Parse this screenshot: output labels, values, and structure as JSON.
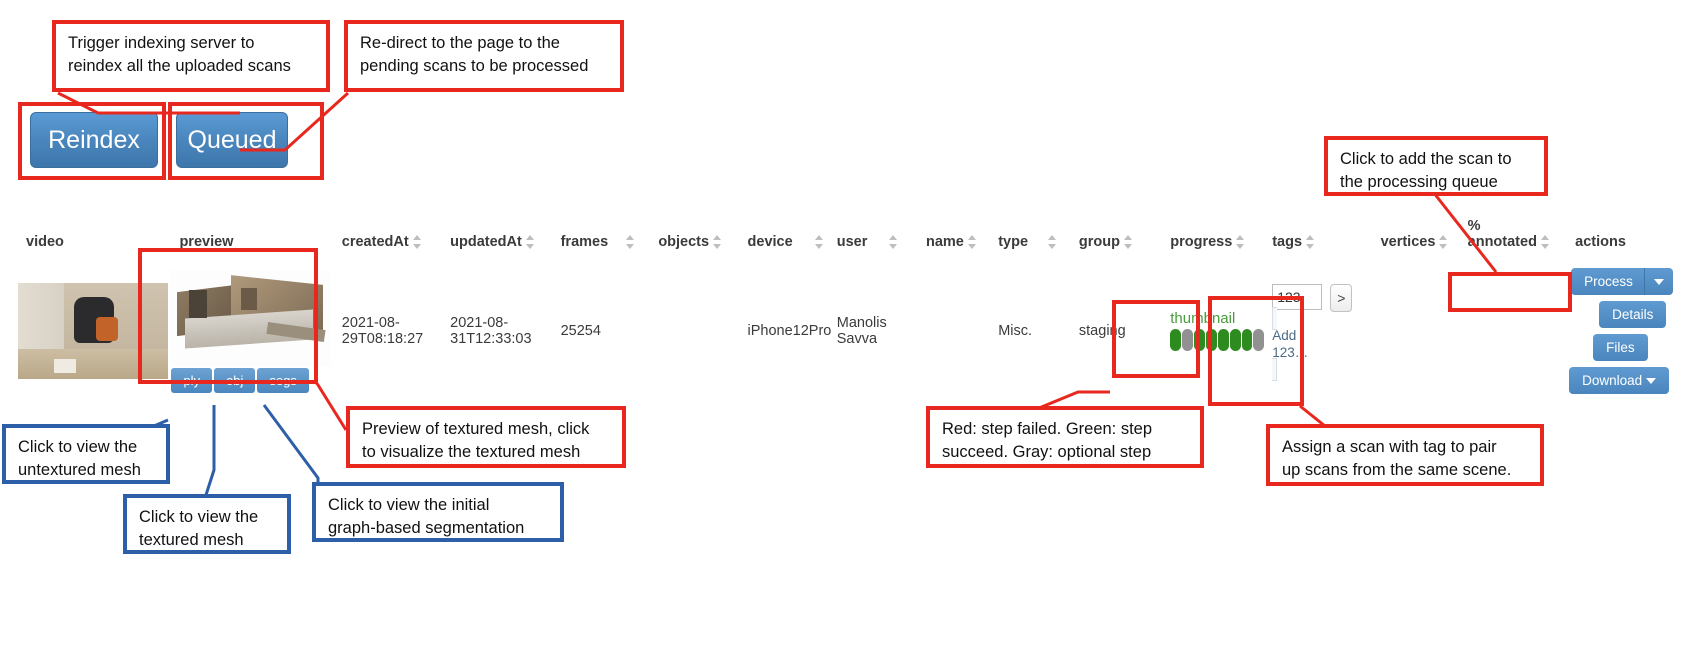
{
  "toolbar": {
    "reindex_label": "Reindex",
    "queued_label": "Queued"
  },
  "table": {
    "headers": [
      {
        "label": "video",
        "sortable": false
      },
      {
        "label": "preview",
        "sortable": false
      },
      {
        "label": "createdAt",
        "sortable": true
      },
      {
        "label": "updatedAt",
        "sortable": true
      },
      {
        "label": "frames",
        "sortable": true
      },
      {
        "label": "objects",
        "sortable": true
      },
      {
        "label": "device",
        "sortable": true
      },
      {
        "label": "user",
        "sortable": true
      },
      {
        "label": "name",
        "sortable": true
      },
      {
        "label": "type",
        "sortable": true
      },
      {
        "label": "group",
        "sortable": true
      },
      {
        "label": "progress",
        "sortable": true
      },
      {
        "label": "tags",
        "sortable": true
      },
      {
        "label": "vertices",
        "sortable": true
      },
      {
        "label": "% annotated",
        "sortable": true
      },
      {
        "label": "actions",
        "sortable": false
      }
    ],
    "row": {
      "created_at_line1": "2021-08-",
      "created_at_line2": "29T08:18:27",
      "updated_at_line1": "2021-08-",
      "updated_at_line2": "31T12:33:03",
      "frames": "25254",
      "objects": "",
      "device": "iPhone12Pro",
      "user_line1": "Manolis",
      "user_line2": "Savva",
      "name": "",
      "type": "Misc.",
      "group": "staging",
      "progress_label": "thumbnail",
      "progress_steps": [
        "green",
        "gray",
        "green",
        "green",
        "green",
        "green",
        "green",
        "gray"
      ],
      "vertices": "",
      "percent_annotated": "",
      "tag_value": "123",
      "tag_go_label": ">",
      "tag_suggestion_line1": "Add",
      "tag_suggestion_line2": "123…",
      "file_buttons": [
        "ply",
        "obj",
        "segs"
      ],
      "actions": {
        "process_label": "Process",
        "details_label": "Details",
        "files_label": "Files",
        "download_label": "Download"
      }
    }
  },
  "annotations": [
    {
      "id": "a1",
      "color": "red",
      "line1": "Trigger indexing server to",
      "line2": "reindex all the uploaded scans"
    },
    {
      "id": "a2",
      "color": "red",
      "line1": "Re-direct to the page to the",
      "line2": "pending scans to be processed"
    },
    {
      "id": "a3",
      "color": "red",
      "line1": "Click to add the scan to",
      "line2": "the processing queue"
    },
    {
      "id": "a4",
      "color": "red",
      "line1": "Preview of textured mesh, click",
      "line2": "to visualize the textured mesh"
    },
    {
      "id": "a5",
      "color": "red",
      "line1": "Red: step failed. Green: step",
      "line2": "succeed. Gray: optional step"
    },
    {
      "id": "a6",
      "color": "red",
      "line1": "Assign a scan with tag to pair",
      "line2": "up scans from the same scene."
    },
    {
      "id": "a7",
      "color": "blue",
      "line1": "Click to view the",
      "line2": "untextured mesh"
    },
    {
      "id": "a8",
      "color": "blue",
      "line1": "Click to view the",
      "line2": "textured mesh"
    },
    {
      "id": "a9",
      "color": "blue",
      "line1": "Click to view the initial",
      "line2": "graph-based segmentation"
    }
  ],
  "colors": {
    "accent_blue": "#4a86bd",
    "callout_red": "#e8281e",
    "callout_blue": "#2d5fa8",
    "step_green": "#2e8b1f",
    "step_gray": "#919191",
    "thumbnail_text_green": "#4a9c3e"
  }
}
